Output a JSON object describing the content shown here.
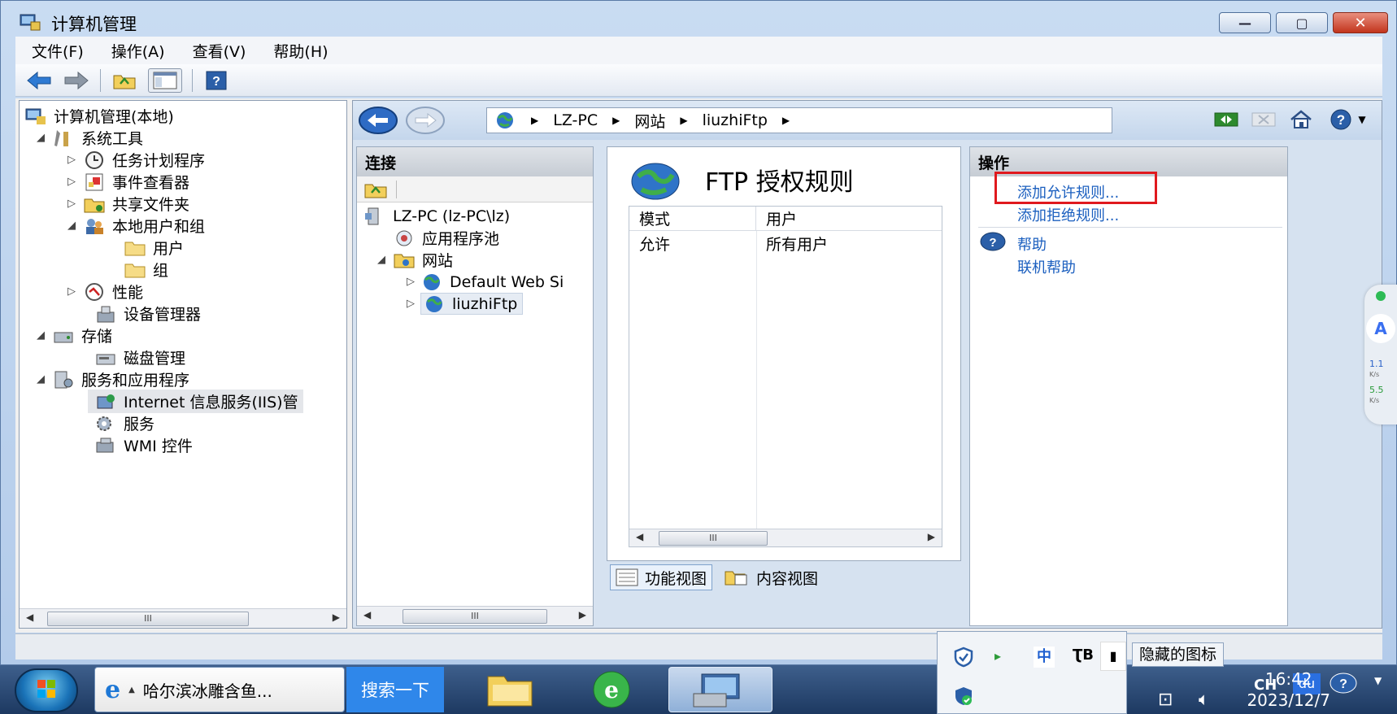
{
  "window": {
    "title": "计算机管理",
    "buttons": {
      "minimize": "—",
      "maximize": "▢",
      "close": "✕"
    }
  },
  "menubar": [
    "文件(F)",
    "操作(A)",
    "查看(V)",
    "帮助(H)"
  ],
  "left_tree": {
    "root": "计算机管理(本地)",
    "items": [
      {
        "label": "系统工具",
        "level": 1,
        "expander": "◢"
      },
      {
        "label": "任务计划程序",
        "level": 2,
        "expander": "▷"
      },
      {
        "label": "事件查看器",
        "level": 2,
        "expander": "▷"
      },
      {
        "label": "共享文件夹",
        "level": 2,
        "expander": "▷"
      },
      {
        "label": "本地用户和组",
        "level": 2,
        "expander": "◢"
      },
      {
        "label": "用户",
        "level": 3,
        "expander": ""
      },
      {
        "label": "组",
        "level": 3,
        "expander": ""
      },
      {
        "label": "性能",
        "level": 2,
        "expander": "▷"
      },
      {
        "label": "设备管理器",
        "level": 2,
        "expander": ""
      },
      {
        "label": "存储",
        "level": 1,
        "expander": "◢"
      },
      {
        "label": "磁盘管理",
        "level": 2,
        "expander": ""
      },
      {
        "label": "服务和应用程序",
        "level": 1,
        "expander": "◢"
      },
      {
        "label": "Internet 信息服务(IIS)管",
        "level": 2,
        "expander": ""
      },
      {
        "label": "服务",
        "level": 2,
        "expander": ""
      },
      {
        "label": "WMI 控件",
        "level": 2,
        "expander": ""
      }
    ]
  },
  "scroll_glyph": "III",
  "iis": {
    "breadcrumb": [
      "LZ-PC",
      "网站",
      "liuzhiFtp"
    ],
    "connections": {
      "title": "连接",
      "tree": [
        {
          "label": "LZ-PC (lz-PC\\lz)",
          "indent": 0
        },
        {
          "label": "应用程序池",
          "indent": 1
        },
        {
          "label": "网站",
          "indent": 1
        },
        {
          "label": "Default Web Si",
          "indent": 2
        },
        {
          "label": "liuzhiFtp",
          "indent": 2
        }
      ]
    },
    "feature": {
      "title": "FTP 授权规则",
      "columns": [
        "模式",
        "用户"
      ],
      "rows": [
        {
          "mode": "允许",
          "user": "所有用户"
        }
      ]
    },
    "view_tabs": [
      "功能视图",
      "内容视图"
    ],
    "actions": {
      "title": "操作",
      "add_allow": "添加允许规则...",
      "add_deny": "添加拒绝规则...",
      "help": "帮助",
      "online_help": "联机帮助"
    }
  },
  "taskbar": {
    "ie_task": "哈尔滨冰雕含鱼...",
    "search": "搜索一下",
    "hidden_icons": "隐藏的图标",
    "lang": "CH",
    "time": "16:42",
    "date": "2023/12/7"
  },
  "tray_popup_icons": [
    "中",
    "ƮB"
  ],
  "side_widget": {
    "up": "1.1",
    "down": "5.5",
    "unit": "K/s"
  },
  "colors": {
    "link": "#1b5fbf",
    "highlight_box": "#e0191e",
    "title_bar": "#c9dcf2"
  }
}
